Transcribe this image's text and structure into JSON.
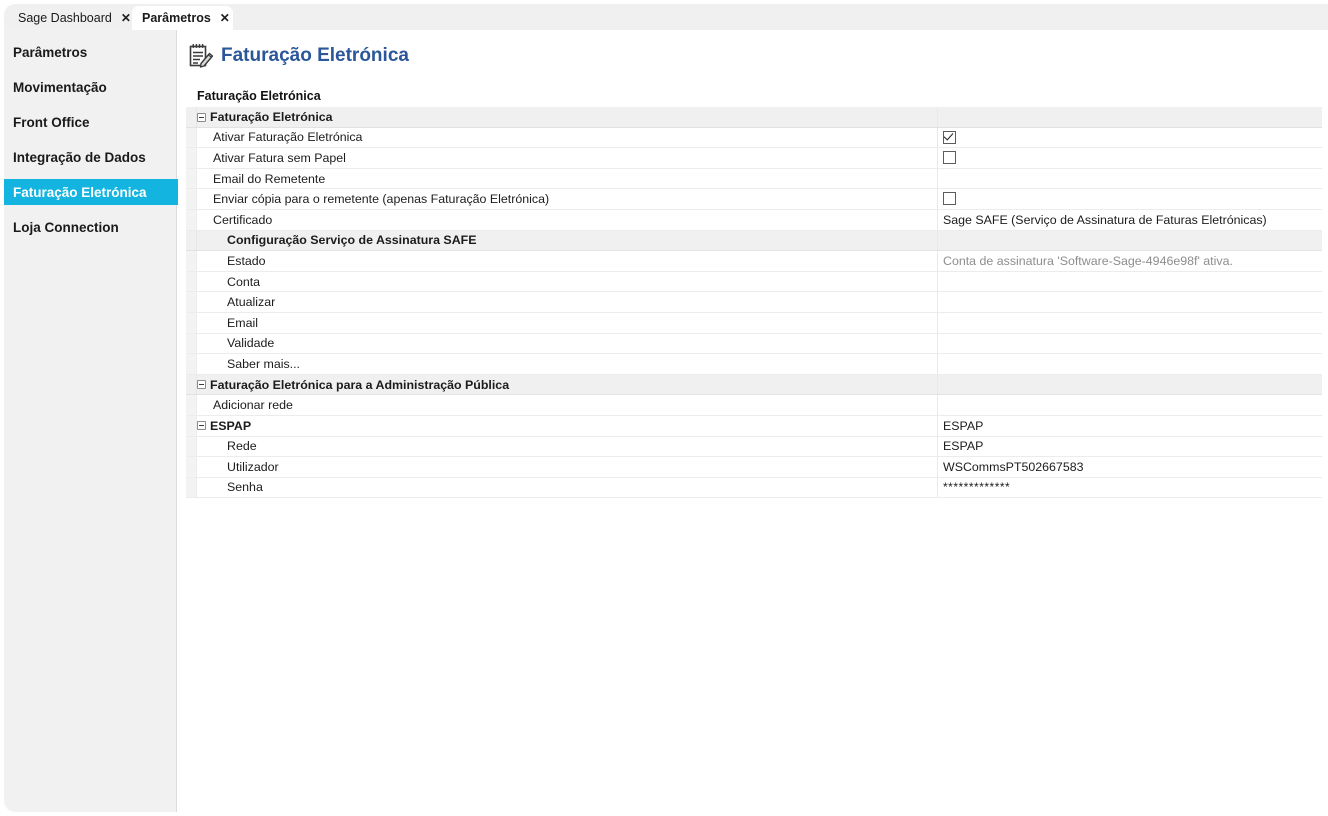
{
  "window": {
    "tabs": [
      {
        "label": "Sage Dashboard",
        "close": "✕",
        "active": false
      },
      {
        "label": "Parâmetros",
        "close": "✕",
        "active": true
      }
    ]
  },
  "sidebar": {
    "items": [
      {
        "label": "Parâmetros",
        "selected": false
      },
      {
        "label": "Movimentação",
        "selected": false
      },
      {
        "label": "Front Office",
        "selected": false
      },
      {
        "label": "Integração de Dados",
        "selected": false
      },
      {
        "label": "Faturação Eletrónica",
        "selected": true
      },
      {
        "label": "Loja Connection",
        "selected": false
      }
    ],
    "accent_color": "#13b5e0"
  },
  "header": {
    "title": "Faturação Eletrónica",
    "icon": "notepad-pen-icon",
    "title_color": "#2b579a"
  },
  "grid": {
    "title": "Faturação Eletrónica",
    "rows": [
      {
        "label": "Faturação Eletrónica",
        "level": 0,
        "expander": true,
        "shaded": true,
        "value_type": "none",
        "value": ""
      },
      {
        "label": "Ativar Faturação Eletrónica",
        "level": 1,
        "expander": false,
        "shaded": false,
        "value_type": "checkbox",
        "checked": true,
        "value": ""
      },
      {
        "label": "Ativar Fatura sem Papel",
        "level": 1,
        "expander": false,
        "shaded": false,
        "value_type": "checkbox",
        "checked": false,
        "value": ""
      },
      {
        "label": "Email do Remetente",
        "level": 1,
        "expander": false,
        "shaded": false,
        "value_type": "text",
        "value": ""
      },
      {
        "label": "Enviar cópia para o remetente (apenas Faturação Eletrónica)",
        "level": 1,
        "expander": false,
        "shaded": false,
        "value_type": "checkbox",
        "checked": false,
        "value": ""
      },
      {
        "label": "Certificado",
        "level": 1,
        "expander": false,
        "shaded": false,
        "value_type": "text",
        "value": "Sage SAFE (Serviço de Assinatura de Faturas Eletrónicas)"
      },
      {
        "label": "Configuração Serviço de Assinatura SAFE",
        "level": 2,
        "expander": false,
        "shaded": true,
        "value_type": "none",
        "value": ""
      },
      {
        "label": "Estado",
        "level": 3,
        "expander": false,
        "shaded": false,
        "value_type": "muted",
        "value": "Conta de assinatura 'Software-Sage-4946e98f' ativa."
      },
      {
        "label": "Conta",
        "level": 3,
        "expander": false,
        "shaded": false,
        "value_type": "text",
        "value": ""
      },
      {
        "label": "Atualizar",
        "level": 3,
        "expander": false,
        "shaded": false,
        "value_type": "text",
        "value": ""
      },
      {
        "label": "Email",
        "level": 3,
        "expander": false,
        "shaded": false,
        "value_type": "text",
        "value": ""
      },
      {
        "label": "Validade",
        "level": 3,
        "expander": false,
        "shaded": false,
        "value_type": "text",
        "value": ""
      },
      {
        "label": "Saber mais...",
        "level": 3,
        "expander": false,
        "shaded": false,
        "value_type": "text",
        "value": ""
      },
      {
        "label": "Faturação Eletrónica para a Administração Pública",
        "level": 0,
        "expander": true,
        "shaded": true,
        "value_type": "none",
        "value": ""
      },
      {
        "label": "Adicionar rede",
        "level": 1,
        "expander": false,
        "shaded": false,
        "value_type": "text",
        "value": ""
      },
      {
        "label": "ESPAP",
        "level": 0,
        "expander": true,
        "shaded": false,
        "value_type": "text",
        "value": "ESPAP"
      },
      {
        "label": "Rede",
        "level": 3,
        "expander": false,
        "shaded": false,
        "value_type": "text",
        "value": "ESPAP"
      },
      {
        "label": "Utilizador",
        "level": 3,
        "expander": false,
        "shaded": false,
        "value_type": "text",
        "value": "WSCommsPT502667583"
      },
      {
        "label": "Senha",
        "level": 3,
        "expander": false,
        "shaded": false,
        "value_type": "mask",
        "value": "*************"
      }
    ]
  }
}
